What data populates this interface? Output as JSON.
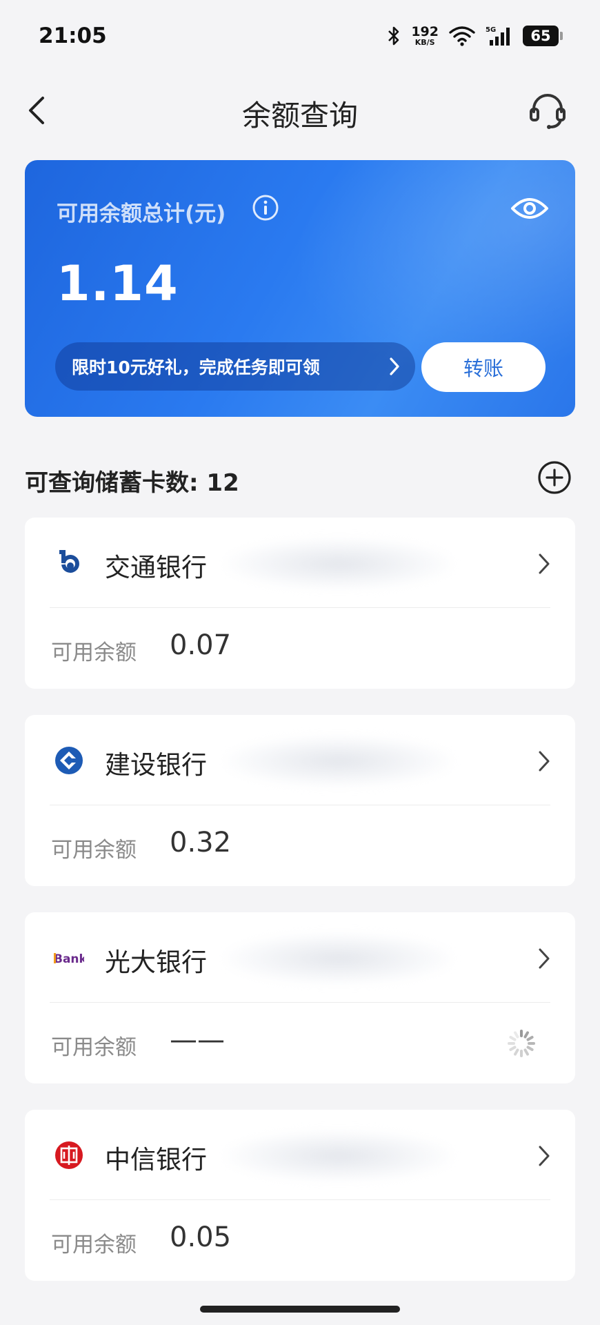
{
  "status_bar": {
    "time": "21:05",
    "net_speed_value": "192",
    "net_speed_unit": "KB/S",
    "network_label": "5G",
    "battery": "65",
    "icons": [
      "bluetooth-icon",
      "wifi-icon",
      "cellular-signal-icon",
      "battery-icon"
    ]
  },
  "nav": {
    "title": "余额查询",
    "icons": [
      "back-icon",
      "headset-icon"
    ]
  },
  "balance_card": {
    "label": "可用余额总计(元)",
    "amount": "1.14",
    "promo_text": "限时10元好礼，完成任务即可领",
    "transfer_label": "转账",
    "colors": {
      "card_gradient_start": "#1e66de",
      "card_gradient_end": "#3b8cf4",
      "transfer_text": "#2a6fd8"
    }
  },
  "section": {
    "card_count_label": "可查询储蓄卡数: 12"
  },
  "banks": [
    {
      "name": "交通银行",
      "balance_label": "可用余额",
      "balance": "0.07",
      "logo": "bankcomm-logo",
      "logo_color": "#1b4d9b"
    },
    {
      "name": "建设银行",
      "balance_label": "可用余额",
      "balance": "0.32",
      "logo": "ccb-logo",
      "logo_color": "#1d5bb5"
    },
    {
      "name": "光大银行",
      "balance_label": "可用余额",
      "balance": "——",
      "logo": "ceb-logo",
      "logo_text": "Bank",
      "logo_color": "#6a2a8c",
      "loading": true
    },
    {
      "name": "中信银行",
      "balance_label": "可用余额",
      "balance": "0.05",
      "logo": "citic-logo",
      "logo_color": "#d71920"
    }
  ]
}
